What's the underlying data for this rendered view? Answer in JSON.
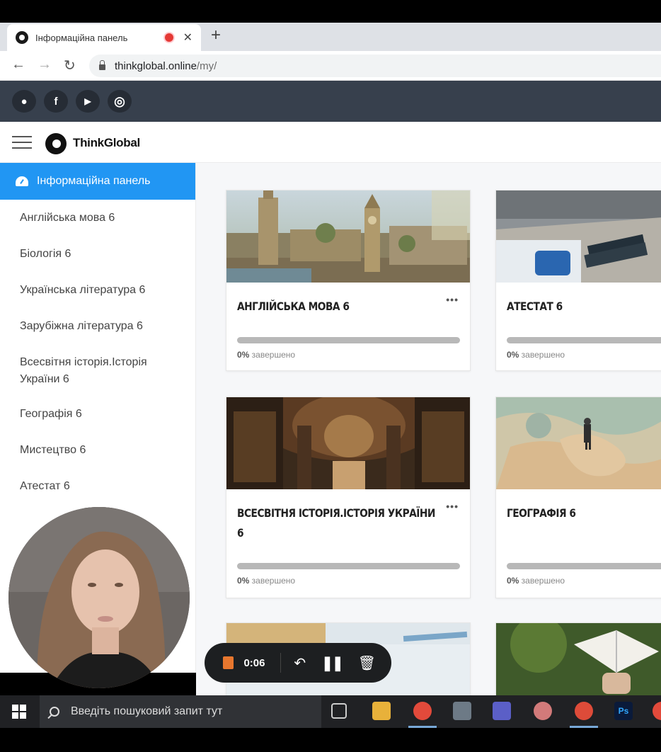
{
  "browser": {
    "tab_title": "Інформаційна панель",
    "tab_close": "✕",
    "new_tab": "+",
    "url_host": "thinkglobal.online",
    "url_path": "/my/"
  },
  "social": {
    "links": [
      {
        "icon": "globe-icon",
        "glyph": "●"
      },
      {
        "icon": "facebook-icon",
        "glyph": "f"
      },
      {
        "icon": "youtube-icon",
        "glyph": "▶"
      },
      {
        "icon": "instagram-icon",
        "glyph": "◎"
      }
    ]
  },
  "header": {
    "logo_text": "ThinkGlobal"
  },
  "sidebar": {
    "items": [
      {
        "label": "Інформаційна панель",
        "active": true
      },
      {
        "label": "Англійська мова 6"
      },
      {
        "label": "Біологія 6"
      },
      {
        "label": "Українська література 6"
      },
      {
        "label": "Зарубіжна література 6"
      },
      {
        "label": "Всесвітня історія.Історія України 6"
      },
      {
        "label": "Географія 6"
      },
      {
        "label": "Мистецтво 6"
      },
      {
        "label": "Атестат 6"
      }
    ]
  },
  "courses": [
    {
      "title": "АНГЛІЙСЬКА МОВА 6",
      "progress": 0,
      "progress_pct": "0%",
      "progress_suffix": " завершено",
      "menu": "•••"
    },
    {
      "title": "АТЕСТАТ 6",
      "progress": 0,
      "progress_pct": "0%",
      "progress_suffix": " завершено",
      "menu": "•••"
    },
    {
      "title": "ВСЕСВІТНЯ ІСТОРІЯ.ІСТОРІЯ УКРАЇНИ 6",
      "progress": 0,
      "progress_pct": "0%",
      "progress_suffix": " завершено",
      "menu": "•••"
    },
    {
      "title": "ГЕОГРАФІЯ 6",
      "progress": 0,
      "progress_pct": "0%",
      "progress_suffix": " завершено",
      "menu": "•••"
    }
  ],
  "recorder": {
    "time": "0:06"
  },
  "taskbar": {
    "search_placeholder": "Введіть пошуковий запит тут",
    "ps_label": "Ps"
  },
  "colors": {
    "accent": "#2196f3",
    "social_bar": "#37404d",
    "recorder_stop": "#e8772e"
  }
}
